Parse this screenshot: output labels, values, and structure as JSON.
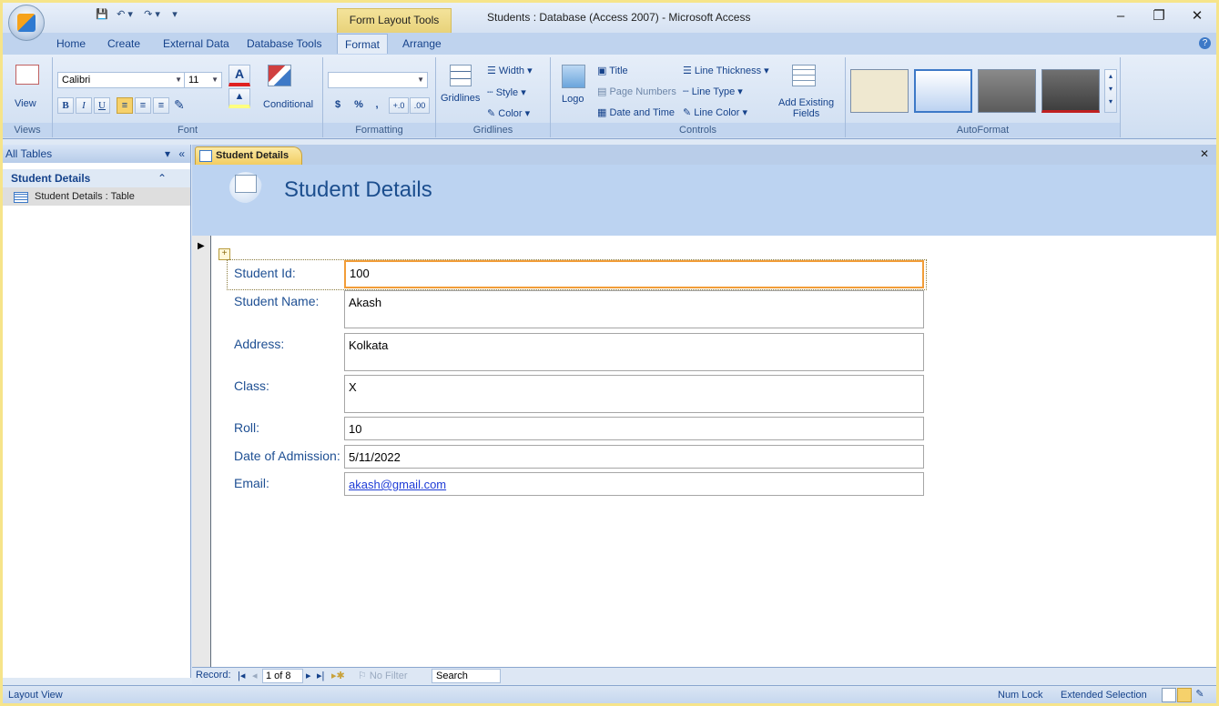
{
  "window": {
    "title": "Students : Database (Access 2007) - Microsoft Access",
    "context_tab": "Form Layout Tools",
    "qat": [
      "💾",
      "↶ ▾",
      "↷ ▾",
      "▾"
    ],
    "controls": {
      "minimize": "–",
      "restore": "❐",
      "close": "✕"
    }
  },
  "ribbon_tabs": [
    "Home",
    "Create",
    "External Data",
    "Database Tools",
    "Format",
    "Arrange"
  ],
  "ribbon": {
    "views": {
      "button": "View",
      "label": "Views"
    },
    "font": {
      "name": "Calibri",
      "size": "11",
      "bold": "B",
      "italic": "I",
      "underline": "U",
      "conditional": "Conditional",
      "label": "Font"
    },
    "formatting": {
      "format_value": "",
      "currency": "$",
      "percent": "%",
      "comma": ",",
      "inc_dec": "+.0",
      "dec_dec": ".00",
      "label": "Formatting"
    },
    "gridlines": {
      "button": "Gridlines",
      "width": "Width",
      "style": "Style",
      "color": "Color",
      "label": "Gridlines"
    },
    "controls": {
      "logo": "Logo",
      "title": "Title",
      "page_numbers": "Page Numbers",
      "date_time": "Date and Time",
      "line_thickness": "Line Thickness",
      "line_type": "Line Type",
      "line_color": "Line Color",
      "add_existing_1": "Add Existing",
      "add_existing_2": "Fields",
      "label": "Controls"
    },
    "autoformat": {
      "label": "AutoFormat"
    }
  },
  "nav": {
    "header": "All Tables",
    "group": "Student Details",
    "item": "Student Details : Table"
  },
  "document": {
    "tab": "Student Details",
    "form_title": "Student Details",
    "fields": [
      {
        "label": "Student Id:",
        "value": "100"
      },
      {
        "label": "Student Name:",
        "value": "Akash"
      },
      {
        "label": "Address:",
        "value": "Kolkata"
      },
      {
        "label": "Class:",
        "value": "X"
      },
      {
        "label": "Roll:",
        "value": "10"
      },
      {
        "label": "Date of Admission:",
        "value": "5/11/2022"
      },
      {
        "label": "Email:",
        "value": "akash@gmail.com"
      }
    ]
  },
  "record_nav": {
    "record_label": "Record:",
    "position": "1 of 8",
    "filter": "No Filter",
    "search": "Search"
  },
  "status": {
    "view": "Layout View",
    "num_lock": "Num Lock",
    "selection": "Extended Selection"
  },
  "colors": {
    "accent": "#15428b",
    "selected_tab": "#f2cd62",
    "focused_border": "#f29d38"
  }
}
